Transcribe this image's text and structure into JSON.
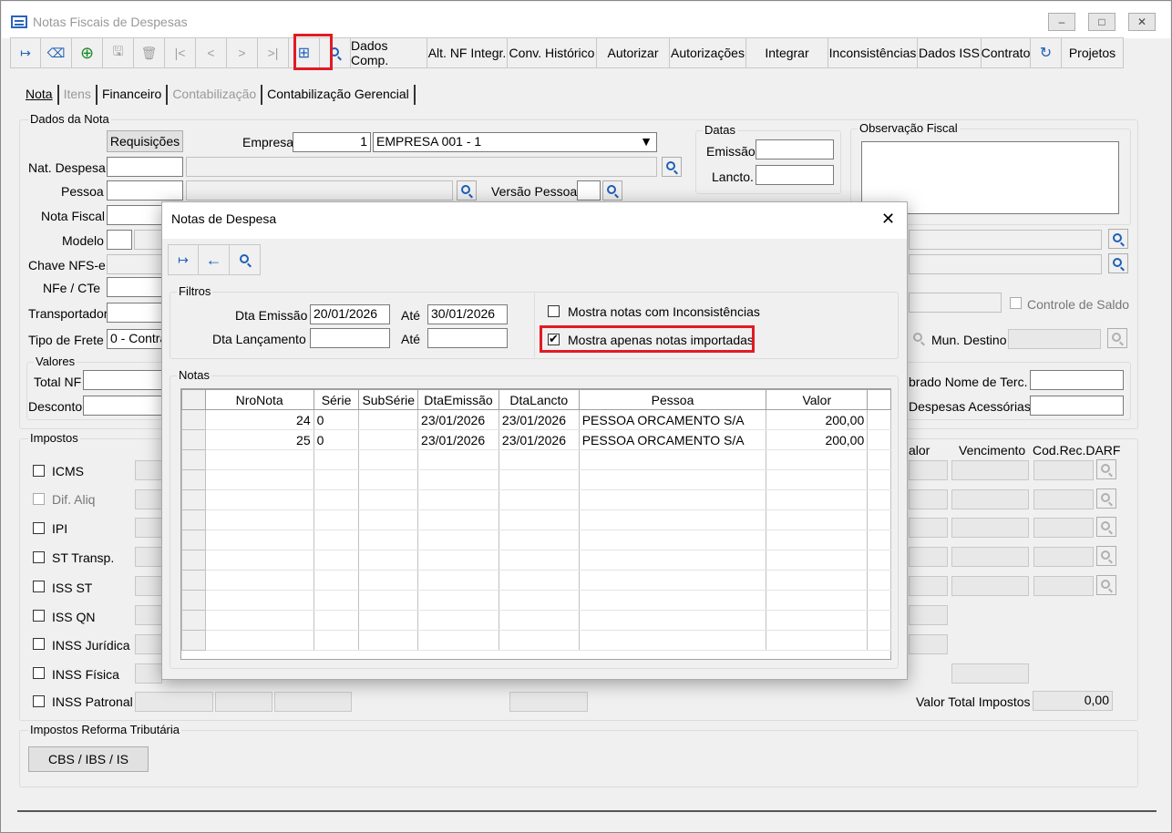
{
  "window": {
    "title": "Notas Fiscais de Despesas"
  },
  "toolbar": {
    "buttons": [
      "Dados Comp.",
      "Alt. NF Integr.",
      "Conv. Histórico",
      "Autorizar",
      "Autorizações",
      "Integrar",
      "Inconsistências",
      "Dados ISS",
      "Contrato",
      "Projetos"
    ]
  },
  "tabs": [
    "Nota",
    "Itens",
    "Financeiro",
    "Contabilização",
    "Contabilização Gerencial"
  ],
  "dados_nota": {
    "group_label": "Dados da Nota",
    "requisicoes": "Requisições",
    "empresa_label": "Empresa",
    "empresa_code": "1",
    "empresa_name": "EMPRESA 001 - 1",
    "nat_despesa": "Nat. Despesa",
    "pessoa": "Pessoa",
    "versao_pessoa": "Versão Pessoa",
    "nota_fiscal": "Nota Fiscal",
    "modelo": "Modelo",
    "chave_nfse": "Chave NFS-e",
    "nfe_cte": "NFe / CTe",
    "transportador": "Transportador",
    "tipo_frete": "Tipo de Frete",
    "tipo_frete_value": "0 - Contra",
    "datas": "Datas",
    "emissao": "Emissão",
    "lancto": "Lancto.",
    "obs_fiscal": "Observação Fiscal",
    "controle_saldo": "Controle de Saldo",
    "mun_destino": "Mun. Destino",
    "valores": "Valores",
    "total_nf": "Total NF",
    "desconto": "Desconto",
    "cobrado_terc": "brado Nome de Terc.",
    "despesas_acess": "Despesas Acessórias"
  },
  "impostos": {
    "group_label": "Impostos",
    "items": [
      "ICMS",
      "Dif. Aliq",
      "IPI",
      "ST Transp.",
      "ISS ST",
      "ISS QN",
      "INSS Jurídica",
      "INSS Física",
      "INSS Patronal"
    ],
    "col_valor": "alor",
    "col_vencimento": "Vencimento",
    "col_cod": "Cod.Rec.DARF",
    "valor_total_label": "Valor Total Impostos",
    "valor_total": "0,00"
  },
  "reforma": {
    "group_label": "Impostos Reforma Tributária",
    "button": "CBS / IBS / IS"
  },
  "dialog": {
    "title": "Notas de Despesa",
    "filtros": "Filtros",
    "dta_emissao": "Dta Emissão",
    "emissao_de": "20/01/2026",
    "ate1": "Até",
    "emissao_ate": "30/01/2026",
    "dta_lancamento": "Dta Lançamento",
    "ate2": "Até",
    "chk_inconsistencias": "Mostra notas com Inconsistências",
    "chk_importadas": "Mostra apenas notas importadas",
    "notas": "Notas",
    "columns": [
      "NroNota",
      "Série",
      "SubSérie",
      "DtaEmissão",
      "DtaLancto",
      "Pessoa",
      "Valor"
    ],
    "rows": [
      [
        "24",
        "0",
        "",
        "23/01/2026",
        "23/01/2026",
        "PESSOA ORCAMENTO S/A",
        "200,00"
      ],
      [
        "25",
        "0",
        "",
        "23/01/2026",
        "23/01/2026",
        "PESSOA ORCAMENTO S/A",
        "200,00"
      ]
    ]
  }
}
